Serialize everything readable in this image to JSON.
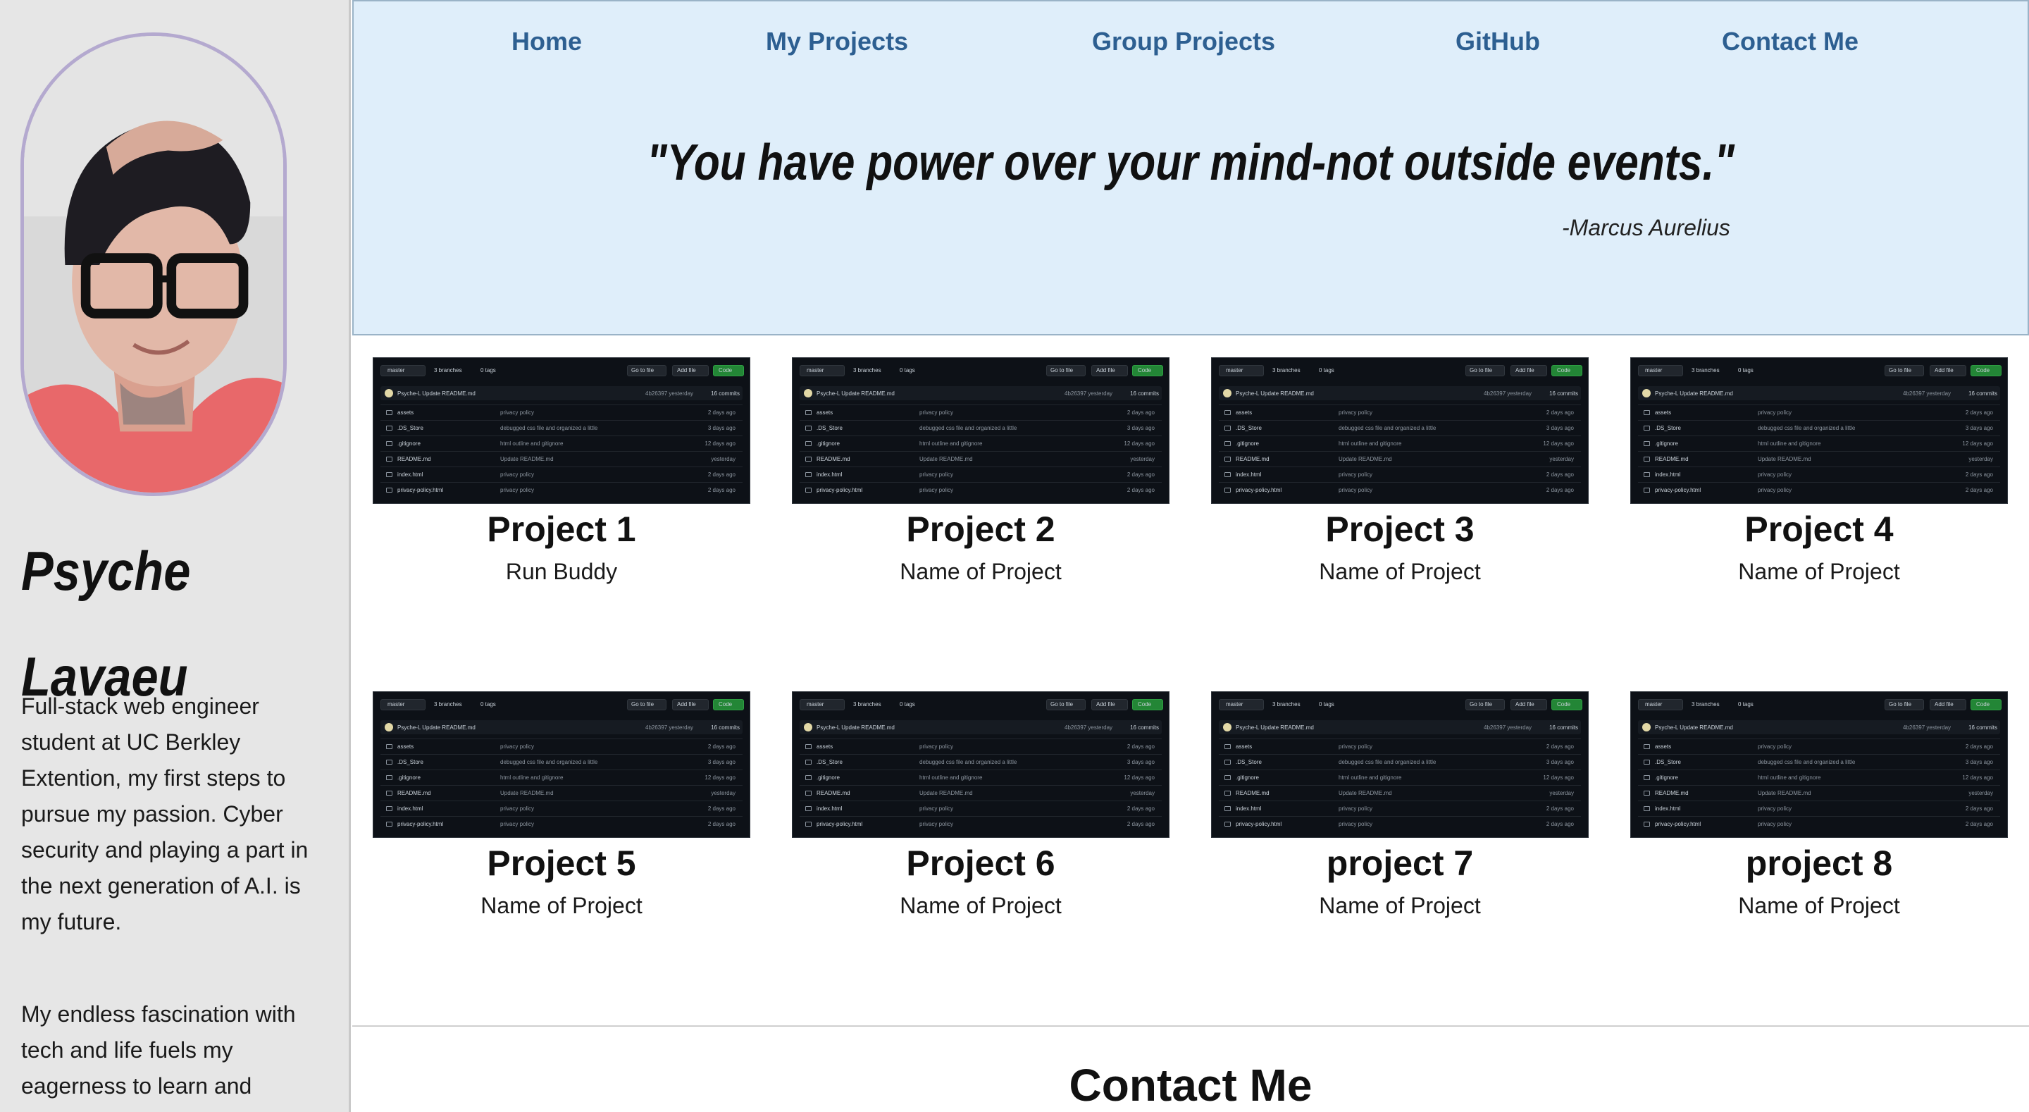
{
  "nav": {
    "items": [
      {
        "label": "Home"
      },
      {
        "label": "My Projects"
      },
      {
        "label": "Group Projects"
      },
      {
        "label": "GitHub"
      },
      {
        "label": "Contact Me"
      }
    ]
  },
  "hero": {
    "quote": "\"You have power over your mind-not outside events.\"",
    "author": "-Marcus Aurelius"
  },
  "sidebar": {
    "name_first": "Psyche",
    "name_last": "Lavaeu",
    "bio_1": "Full-stack web engineer student at UC Berkley Extention, my first steps to pursue my passion. Cyber security and playing a part in the next generation of A.I. is my future.",
    "bio_2": "My endless fascination with tech and life fuels my eagerness to learn and"
  },
  "projects": [
    {
      "title": "Project 1",
      "subtitle": "Run Buddy"
    },
    {
      "title": "Project 2",
      "subtitle": "Name of Project"
    },
    {
      "title": "Project 3",
      "subtitle": "Name of Project"
    },
    {
      "title": "Project 4",
      "subtitle": "Name of Project"
    },
    {
      "title": "Project 5",
      "subtitle": "Name of Project"
    },
    {
      "title": "Project 6",
      "subtitle": "Name of Project"
    },
    {
      "title": "project 7",
      "subtitle": "Name of Project"
    },
    {
      "title": "project 8",
      "subtitle": "Name of Project"
    }
  ],
  "repo_thumbnail": {
    "branch": "master",
    "branches": "3 branches",
    "tags": "0 tags",
    "go_to_file": "Go to file",
    "add_file": "Add file",
    "code": "Code",
    "commit_message": "Psyche-L Update README.md",
    "commit_meta": "4b26397 yesterday",
    "commit_count": "16 commits",
    "files": [
      {
        "name": "assets",
        "message": "privacy policy",
        "date": "2 days ago"
      },
      {
        "name": ".DS_Store",
        "message": "debugged css file and organized a little",
        "date": "3 days ago"
      },
      {
        "name": ".gitignore",
        "message": "html outline and gitignore",
        "date": "12 days ago"
      },
      {
        "name": "README.md",
        "message": "Update README.md",
        "date": "yesterday"
      },
      {
        "name": "index.html",
        "message": "privacy policy",
        "date": "2 days ago"
      },
      {
        "name": "privacy-policy.html",
        "message": "privacy policy",
        "date": "2 days ago"
      }
    ]
  },
  "contact": {
    "heading": "Contact Me"
  },
  "colors": {
    "header_bg": "#dfeefa",
    "nav_link": "#2d5f91",
    "sidebar_bg": "#e6e6e6",
    "avatar_border": "#b4a9cf",
    "thumb_bg": "#0d1117",
    "code_button": "#238636"
  }
}
